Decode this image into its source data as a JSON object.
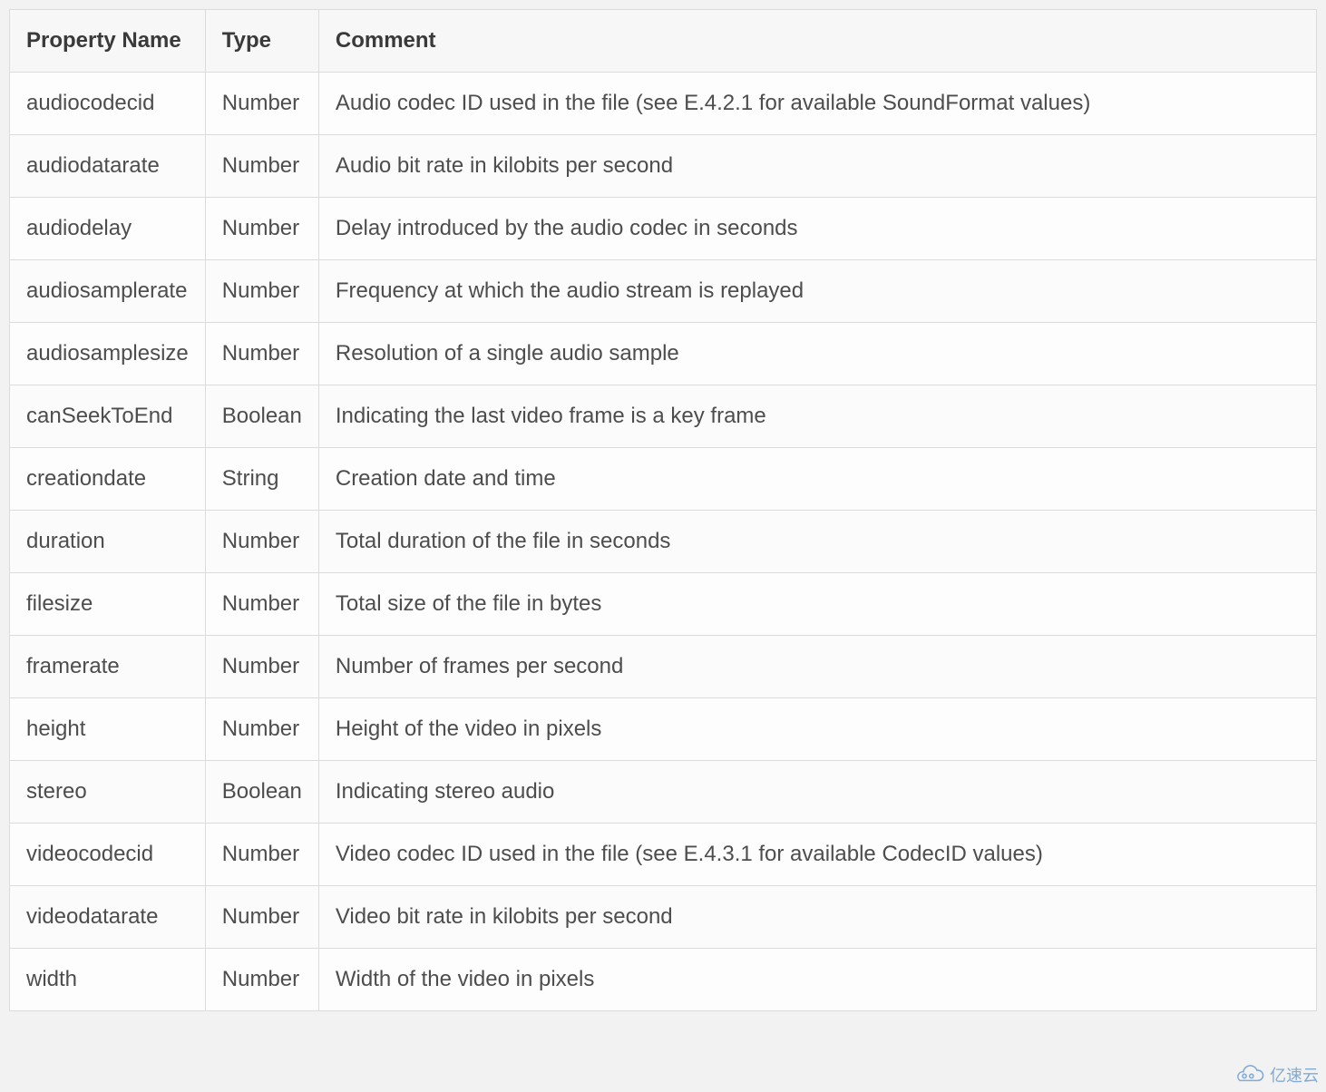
{
  "table": {
    "headers": {
      "property": "Property Name",
      "type": "Type",
      "comment": "Comment"
    },
    "rows": [
      {
        "property": "audiocodecid",
        "type": "Number",
        "comment": "Audio codec ID used in the file (see E.4.2.1 for available SoundFormat values)"
      },
      {
        "property": "audiodatarate",
        "type": "Number",
        "comment": "Audio bit rate in kilobits per second"
      },
      {
        "property": "audiodelay",
        "type": "Number",
        "comment": "Delay introduced by the audio codec in seconds"
      },
      {
        "property": "audiosamplerate",
        "type": "Number",
        "comment": "Frequency at which the audio stream is replayed"
      },
      {
        "property": "audiosamplesize",
        "type": "Number",
        "comment": "Resolution of a single audio sample"
      },
      {
        "property": "canSeekToEnd",
        "type": "Boolean",
        "comment": "Indicating the last video frame is a key frame"
      },
      {
        "property": "creationdate",
        "type": "String",
        "comment": "Creation date and time"
      },
      {
        "property": "duration",
        "type": "Number",
        "comment": "Total duration of the file in seconds"
      },
      {
        "property": "filesize",
        "type": "Number",
        "comment": "Total size of the file in bytes"
      },
      {
        "property": "framerate",
        "type": "Number",
        "comment": "Number of frames per second"
      },
      {
        "property": "height",
        "type": "Number",
        "comment": "Height of the video in pixels"
      },
      {
        "property": "stereo",
        "type": "Boolean",
        "comment": "Indicating stereo audio"
      },
      {
        "property": "videocodecid",
        "type": "Number",
        "comment": "Video codec ID used in the file (see E.4.3.1 for available CodecID values)"
      },
      {
        "property": "videodatarate",
        "type": "Number",
        "comment": "Video bit rate in kilobits per second"
      },
      {
        "property": "width",
        "type": "Number",
        "comment": "Width of the video in pixels"
      }
    ]
  },
  "watermark": {
    "text": "亿速云"
  }
}
